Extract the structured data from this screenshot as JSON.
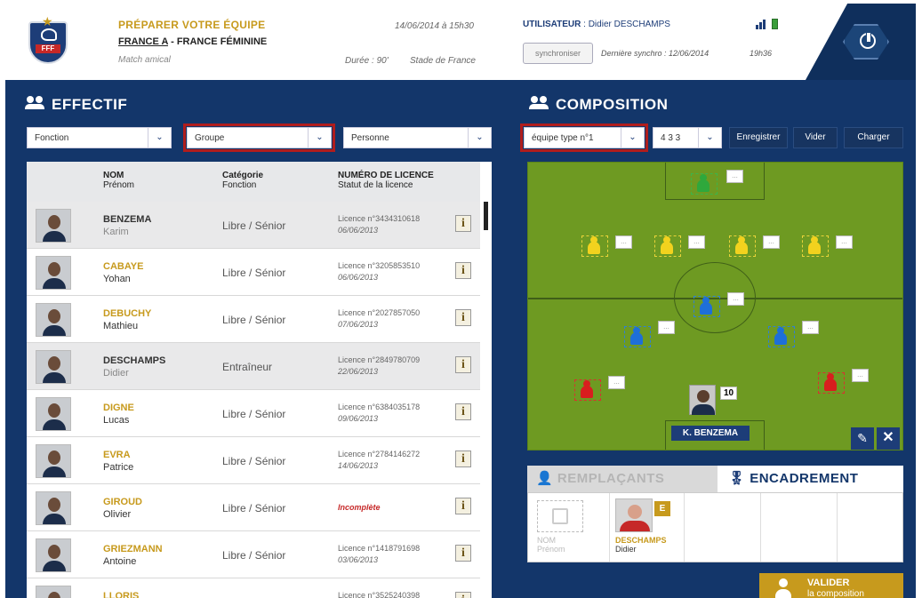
{
  "header": {
    "title": "PRÉPARER VOTRE ÉQUIPE",
    "team_a": "FRANCE A",
    "team_sep": "-",
    "team_b": "FRANCE FÉMININE",
    "match_type": "Match amical",
    "datetime": "14/06/2014 à 15h30",
    "duration": "Durée : 90'",
    "venue": "Stade de France",
    "user_label": "UTILISATEUR",
    "user_name": ": Didier DESCHAMPS",
    "sync_button": "synchroniser",
    "last_sync": "Dernière synchro : 12/06/2014",
    "last_sync_time": "19h36",
    "logo_text": "FFF"
  },
  "effectif": {
    "title": "EFFECTIF",
    "filters": {
      "fonction": "Fonction",
      "groupe": "Groupe",
      "personne": "Personne"
    },
    "columns": {
      "nom": "NOM",
      "prenom": "Prénom",
      "categorie": "Catégorie",
      "fonction": "Fonction",
      "licence": "NUMÉRO DE LICENCE",
      "statut": "Statut de la licence"
    },
    "info_label": "i",
    "players": [
      {
        "nom": "BENZEMA",
        "prenom": "Karim",
        "categorie": "Libre / Sénior",
        "licence": "Licence n°3434310618",
        "date": "06/06/2013"
      },
      {
        "nom": "CABAYE",
        "prenom": "Yohan",
        "categorie": "Libre / Sénior",
        "licence": "Licence n°3205853510",
        "date": "06/06/2013"
      },
      {
        "nom": "DEBUCHY",
        "prenom": "Mathieu",
        "categorie": "Libre / Sénior",
        "licence": "Licence n°2027857050",
        "date": "07/06/2013"
      },
      {
        "nom": "DESCHAMPS",
        "prenom": "Didier",
        "categorie": "Entraîneur",
        "licence": "Licence n°2849780709",
        "date": "22/06/2013"
      },
      {
        "nom": "DIGNE",
        "prenom": "Lucas",
        "categorie": "Libre / Sénior",
        "licence": "Licence n°6384035178",
        "date": "09/06/2013"
      },
      {
        "nom": "EVRA",
        "prenom": "Patrice",
        "categorie": "Libre / Sénior",
        "licence": "Licence n°2784146272",
        "date": "14/06/2013"
      },
      {
        "nom": "GIROUD",
        "prenom": "Olivier",
        "categorie": "Libre / Sénior",
        "licence": "Incomplète",
        "date": ""
      },
      {
        "nom": "GRIEZMANN",
        "prenom": "Antoine",
        "categorie": "Libre / Sénior",
        "licence": "Licence n°1418791698",
        "date": "03/06/2013"
      },
      {
        "nom": "LLORIS",
        "prenom": "",
        "categorie": "",
        "licence": "Licence n°3525240398",
        "date": ""
      }
    ]
  },
  "composition": {
    "title": "COMPOSITION",
    "team_select": "équipe type n°1",
    "formation_select": "4 3 3",
    "save": "Enregistrer",
    "clear": "Vider",
    "load": "Charger",
    "badge_placeholder": "...",
    "featured_number": "10",
    "featured_name": "K. BENZEMA"
  },
  "tabs": {
    "remplacants": "REMPLAÇANTS",
    "encadrement": "ENCADREMENT"
  },
  "staff": {
    "empty_nom": "NOM",
    "empty_prenom": "Prénom",
    "coach_role": "E",
    "coach_nom": "DESCHAMPS",
    "coach_prenom": "Didier"
  },
  "valider": {
    "line1": "VALIDER",
    "line2": "la composition"
  },
  "colors": {
    "navy": "#13366a",
    "gold": "#c79a1d",
    "pitch": "#6e9a22",
    "highlight": "#b01d1d"
  }
}
